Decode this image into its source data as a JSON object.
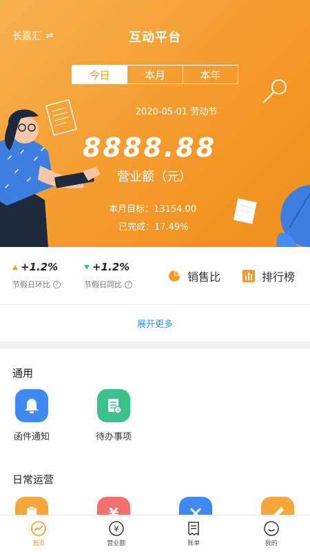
{
  "header": {
    "store_name": "长嘉汇",
    "title": "互动平台"
  },
  "period_tabs": [
    {
      "label": "今日",
      "active": true
    },
    {
      "label": "本月",
      "active": false
    },
    {
      "label": "本年",
      "active": false
    }
  ],
  "summary": {
    "date": "2020-05-01 劳动节",
    "amount": "8888.88",
    "amount_label": "营业额（元）",
    "monthly_target": "本月目标：13154.00",
    "completed": "已完成：17.49%"
  },
  "stats": [
    {
      "value": "+1.2%",
      "trend": "up",
      "label": "节假日环比"
    },
    {
      "value": "+1.2%",
      "trend": "down",
      "label": "节假日同比"
    }
  ],
  "quick_links": [
    {
      "label": "销售比",
      "icon": "pie-chart-icon"
    },
    {
      "label": "排行榜",
      "icon": "bar-chart-icon"
    }
  ],
  "expand_more": "展开更多",
  "sections": {
    "general": {
      "title": "通用",
      "items": [
        {
          "label": "函件通知",
          "icon": "bell-icon",
          "color": "#3d8bf0"
        },
        {
          "label": "待办事项",
          "icon": "todo-list-icon",
          "color": "#3cc08c"
        }
      ]
    },
    "daily": {
      "title": "日常运营",
      "items": [
        {
          "icon": "clipboard-icon",
          "color": "#f6a83a"
        },
        {
          "icon": "yen-icon",
          "color": "#f27272"
        },
        {
          "icon": "tools-icon",
          "color": "#3d8bf0"
        },
        {
          "icon": "pencil-icon",
          "color": "#f6a83a"
        }
      ]
    }
  },
  "tabbar": [
    {
      "label": "首页",
      "icon": "home-chart-icon",
      "active": true
    },
    {
      "label": "营业额",
      "icon": "yen-circle-icon",
      "active": false
    },
    {
      "label": "账单",
      "icon": "receipt-icon",
      "active": false
    },
    {
      "label": "我的",
      "icon": "smile-icon",
      "active": false
    }
  ],
  "colors": {
    "accent": "#f39a2c",
    "link": "#3a8ee6",
    "up": "#f39a2c",
    "down": "#3bbf9e"
  }
}
